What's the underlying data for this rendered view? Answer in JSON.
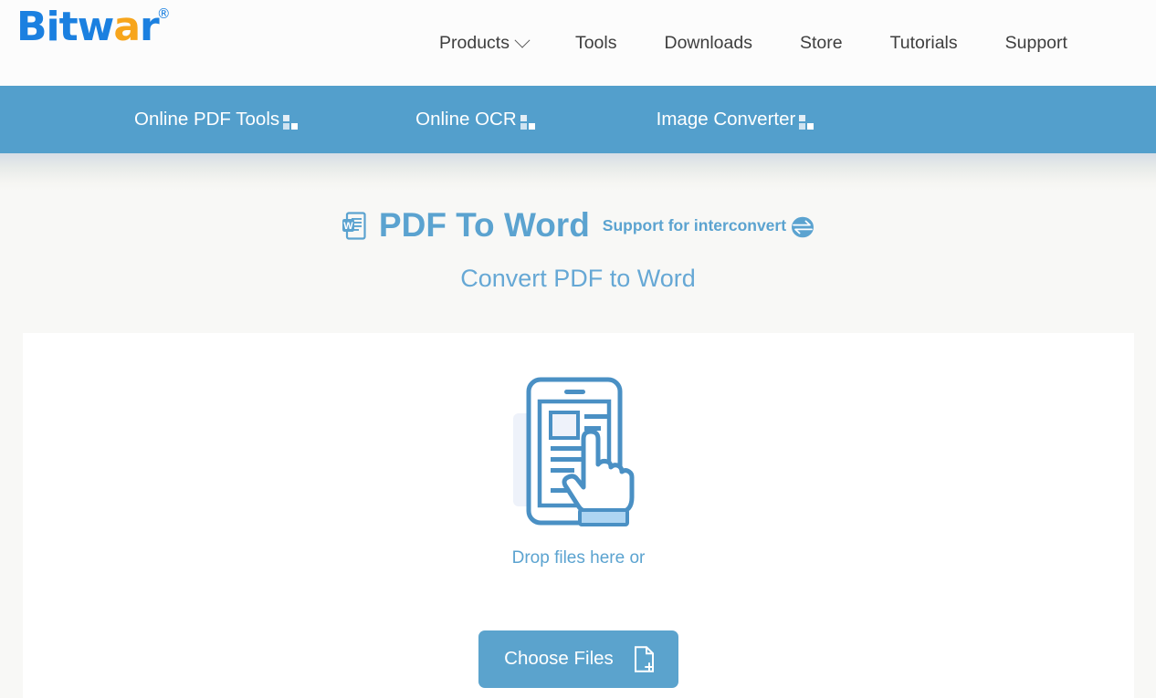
{
  "brand": {
    "name_part1": "Bitw",
    "name_part2": "a",
    "name_part3": "r",
    "registered_mark": "®",
    "color_blue": "#1b80e0",
    "color_orange": "#f7a51c"
  },
  "header": {
    "nav_items": [
      {
        "label": "Products",
        "has_dropdown": true
      },
      {
        "label": "Tools",
        "has_dropdown": false
      },
      {
        "label": "Downloads",
        "has_dropdown": false
      },
      {
        "label": "Store",
        "has_dropdown": false
      },
      {
        "label": "Tutorials",
        "has_dropdown": false
      },
      {
        "label": "Support",
        "has_dropdown": false
      }
    ]
  },
  "subnav": {
    "background_color": "#539fcc",
    "items": [
      {
        "label": "Online PDF Tools",
        "icon": "grid-icon"
      },
      {
        "label": "Online OCR",
        "icon": "grid-icon"
      },
      {
        "label": "Image Converter",
        "icon": "grid-icon"
      }
    ]
  },
  "hero": {
    "icon": "word-document-icon",
    "title": "PDF To Word",
    "support_text": "Support for interconvert",
    "swap_icon": "interconvert-swap-icon",
    "subtitle": "Convert PDF to Word",
    "accent_color": "#5ba3d0"
  },
  "dropzone": {
    "illustration": "tablet-hand-tap-icon",
    "drop_text": "Drop files here or",
    "choose_button_label": "Choose Files",
    "choose_button_icon": "file-plus-icon",
    "button_color": "#5ba3cd"
  }
}
